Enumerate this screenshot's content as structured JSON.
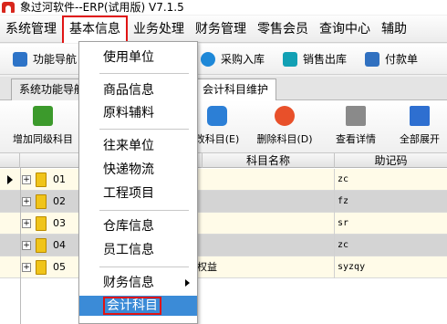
{
  "window": {
    "title": "象过河软件--ERP(试用版) V7.1.5"
  },
  "menubar": {
    "items": [
      "系统管理",
      "基本信息",
      "业务处理",
      "财务管理",
      "零售会员",
      "查询中心",
      "辅助"
    ]
  },
  "quickbar": {
    "items": [
      {
        "label": "功能导航",
        "icon": "home-icon",
        "color": "#2d73c7"
      },
      {
        "label": "采购入库",
        "icon": "purchase-icon",
        "color": "#1e88d8"
      },
      {
        "label": "销售出库",
        "icon": "sales-icon",
        "color": "#12a0b4"
      },
      {
        "label": "付款单",
        "icon": "payment-icon",
        "color": "#3070c0"
      }
    ]
  },
  "tabs": [
    {
      "label": "系统功能导航"
    },
    {
      "label": "会计科目维护"
    }
  ],
  "toolbar": {
    "add_sibling": "增加同级科目",
    "edit": "改科目(E)",
    "delete": "删除科目(D)",
    "view_detail": "查看详情",
    "expand_all": "全部展开"
  },
  "grid": {
    "headers": {
      "code": "科",
      "name": "科目名称",
      "mnemonic": "助记码"
    },
    "rows": [
      {
        "code": "01",
        "name": "",
        "mnemonic": "zc"
      },
      {
        "code": "02",
        "name": "",
        "mnemonic": "fz"
      },
      {
        "code": "03",
        "name": "",
        "mnemonic": "sr"
      },
      {
        "code": "04",
        "name": "",
        "mnemonic": "zc"
      },
      {
        "code": "05",
        "name": "权益",
        "mnemonic": "syzqy"
      }
    ]
  },
  "dropdown": {
    "items": [
      {
        "label": "使用单位"
      },
      {
        "label": "商品信息"
      },
      {
        "label": "原料辅料"
      },
      {
        "label": "往来单位"
      },
      {
        "label": "快递物流"
      },
      {
        "label": "工程项目"
      },
      {
        "label": "仓库信息"
      },
      {
        "label": "员工信息"
      },
      {
        "label": "财务信息"
      },
      {
        "label": "会计科目"
      }
    ]
  },
  "colors": {
    "highlight_border": "#e01414",
    "selection": "#3b8bd7"
  }
}
